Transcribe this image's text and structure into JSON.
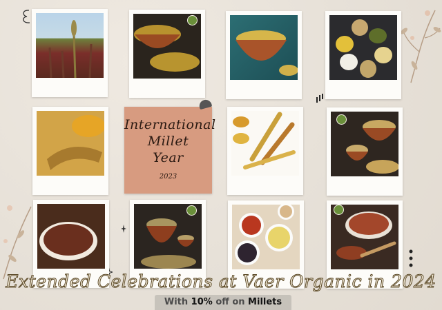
{
  "card": {
    "title_lines": [
      "International",
      "Millet",
      "Year"
    ],
    "year": "2023"
  },
  "headline": "Extended Celebrations at Vaer Organic in 2024",
  "offer": {
    "with": "With",
    "percent": "10%",
    "mid": "off on",
    "product": "Millets"
  },
  "colors": {
    "background": "#eae4dc",
    "card": "#d79b80",
    "headline_fill": "#f3ead7",
    "headline_outline": "#5c4a28"
  },
  "photos": [
    {
      "subject": "millet-field"
    },
    {
      "subject": "millet-bowl"
    },
    {
      "subject": "millet-clay-pot"
    },
    {
      "subject": "millet-spoons"
    },
    {
      "subject": "millet-scoop-bowl"
    },
    {
      "subject": "millet-ears"
    },
    {
      "subject": "millet-pots"
    },
    {
      "subject": "ragi-bowl"
    },
    {
      "subject": "millet-pot-small"
    },
    {
      "subject": "millet-bowls-assorted"
    },
    {
      "subject": "ragi-spoon"
    }
  ]
}
